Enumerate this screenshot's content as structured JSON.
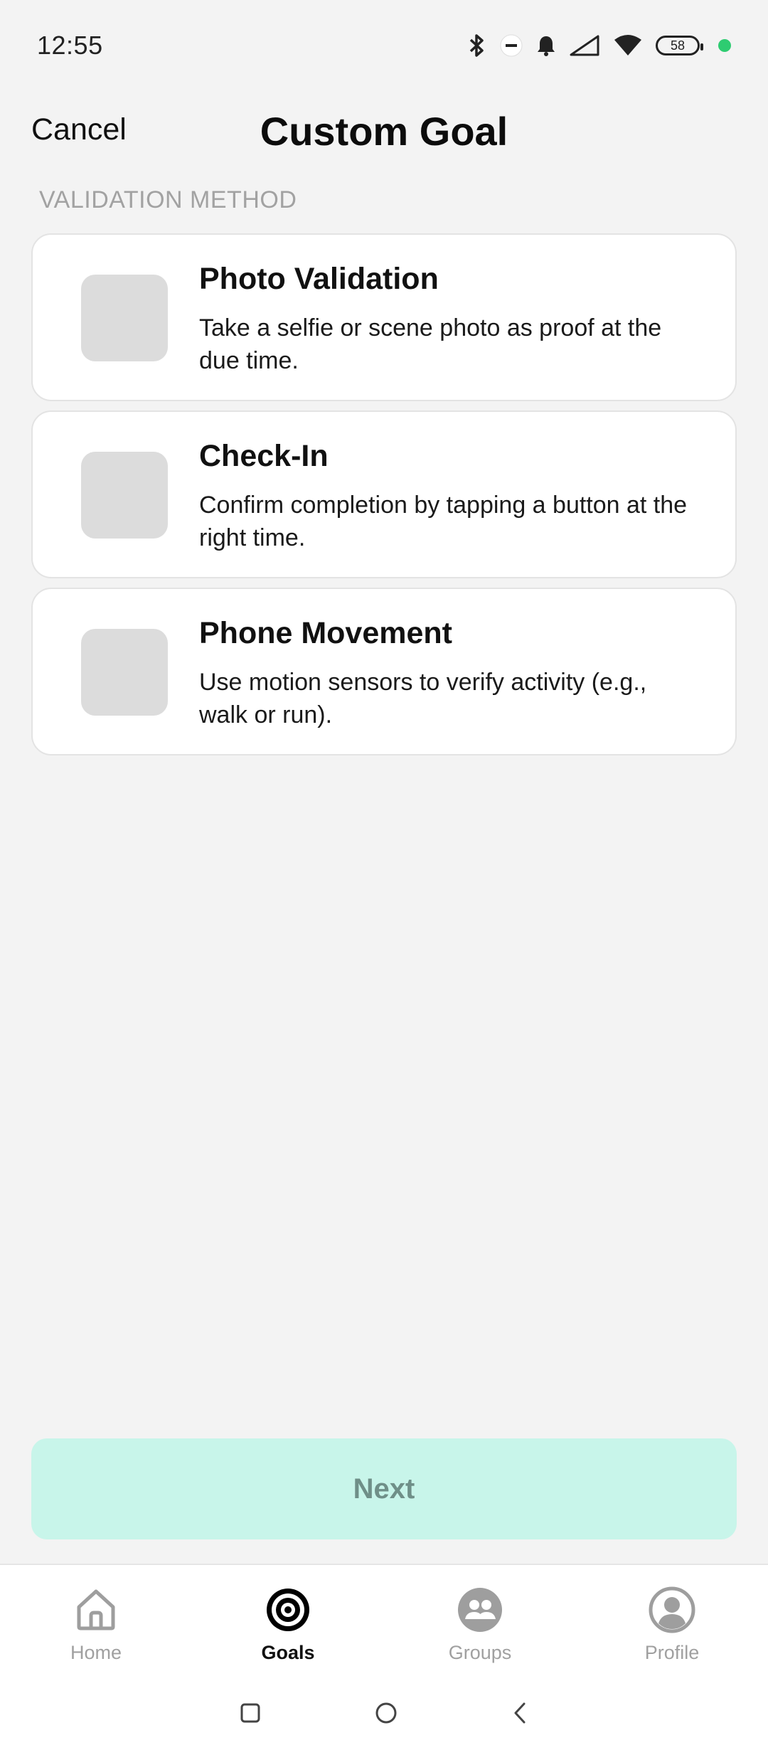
{
  "status_bar": {
    "time": "12:55",
    "battery": "58",
    "icons": [
      "bluetooth-icon",
      "dnd-icon",
      "bell-icon",
      "signal-icon",
      "wifi-icon",
      "battery-icon"
    ]
  },
  "header": {
    "cancel_label": "Cancel",
    "title": "Custom Goal"
  },
  "section_label": "VALIDATION METHOD",
  "options": [
    {
      "title": "Photo Validation",
      "description": "Take a selfie or scene photo as proof at the due time."
    },
    {
      "title": "Check-In",
      "description": "Confirm completion by tapping a button at the right time."
    },
    {
      "title": "Phone Movement",
      "description": "Use motion sensors to verify activity (e.g., walk or run)."
    }
  ],
  "next_label": "Next",
  "bottom_nav": {
    "items": [
      {
        "label": "Home",
        "icon": "home-icon",
        "active": false
      },
      {
        "label": "Goals",
        "icon": "target-icon",
        "active": true
      },
      {
        "label": "Groups",
        "icon": "groups-icon",
        "active": false
      },
      {
        "label": "Profile",
        "icon": "profile-icon",
        "active": false
      }
    ]
  },
  "colors": {
    "background": "#f3f3f3",
    "next_button_bg": "#c8f5ea",
    "next_button_text": "#6f8f88",
    "placeholder_icon": "#dcdcdc",
    "status_dot": "#2ecc71"
  }
}
